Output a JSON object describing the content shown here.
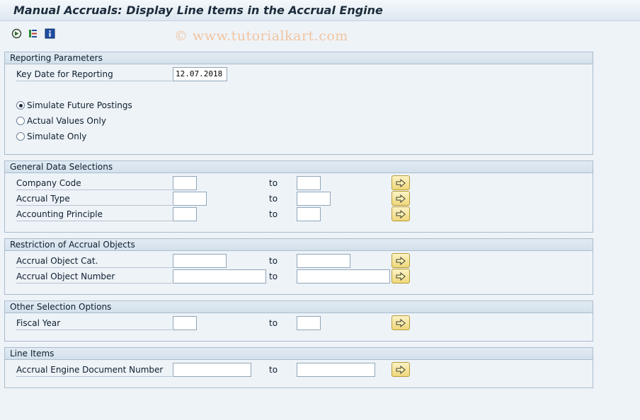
{
  "window": {
    "title": "Manual Accruals: Display Line Items in the Accrual Engine"
  },
  "toolbar": {
    "icons": [
      "execute-icon",
      "selection-options-icon",
      "info-icon"
    ],
    "watermark": "© www.tutorialkart.com"
  },
  "reporting": {
    "header": "Reporting Parameters",
    "key_date_label": "Key Date for Reporting",
    "key_date_value": "12.07.2018",
    "options": [
      {
        "label": "Simulate Future Postings",
        "selected": true
      },
      {
        "label": "Actual Values Only",
        "selected": false
      },
      {
        "label": "Simulate Only",
        "selected": false
      }
    ]
  },
  "general": {
    "header": "General Data Selections",
    "rows": [
      {
        "label": "Company Code",
        "from": "",
        "to_label": "to",
        "to": ""
      },
      {
        "label": "Accrual Type",
        "from": "",
        "to_label": "to",
        "to": ""
      },
      {
        "label": "Accounting Principle",
        "from": "",
        "to_label": "to",
        "to": ""
      }
    ]
  },
  "restriction": {
    "header": "Restriction of Accrual Objects",
    "rows": [
      {
        "label": "Accrual Object Cat.",
        "from": "",
        "to_label": "to",
        "to": ""
      },
      {
        "label": "Accrual Object Number",
        "from": "",
        "to_label": "to",
        "to": ""
      }
    ]
  },
  "other": {
    "header": "Other Selection Options",
    "rows": [
      {
        "label": "Fiscal Year",
        "from": "",
        "to_label": "to",
        "to": ""
      }
    ]
  },
  "line_items": {
    "header": "Line Items",
    "rows": [
      {
        "label": "Accrual Engine Document Number",
        "from": "",
        "to_label": "to",
        "to": ""
      }
    ]
  },
  "colors": {
    "background": "#eef3f8",
    "button_fill": "#efd77a",
    "border": "#a9bccd"
  }
}
